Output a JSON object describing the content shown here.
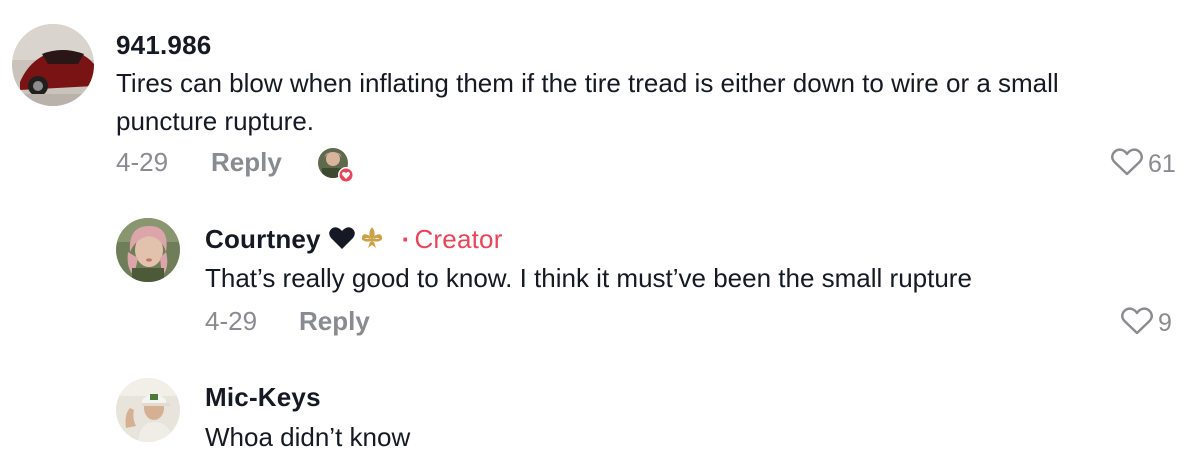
{
  "comments": [
    {
      "username": "941.986",
      "text": "Tires can blow when inflating them if the tire tread is either down to wire or a small puncture rupture.",
      "date": "4-29",
      "reply_label": "Reply",
      "likes": "61"
    },
    {
      "username": "Courtney",
      "emoji": "🖤⚜️",
      "separator": "·",
      "badge": "Creator",
      "text": "That’s really good to know. I think it must’ve been the small rupture",
      "date": "4-29",
      "reply_label": "Reply",
      "likes": "9"
    },
    {
      "username": "Mic-Keys",
      "text": "Whoa didn’t know"
    }
  ],
  "icons": {
    "like": "heart-outline-icon",
    "creator_liked": "creator-liked-avatar-icon"
  },
  "colors": {
    "creator_accent": "#e8445a",
    "muted": "#8a8b91",
    "text": "#161823"
  }
}
